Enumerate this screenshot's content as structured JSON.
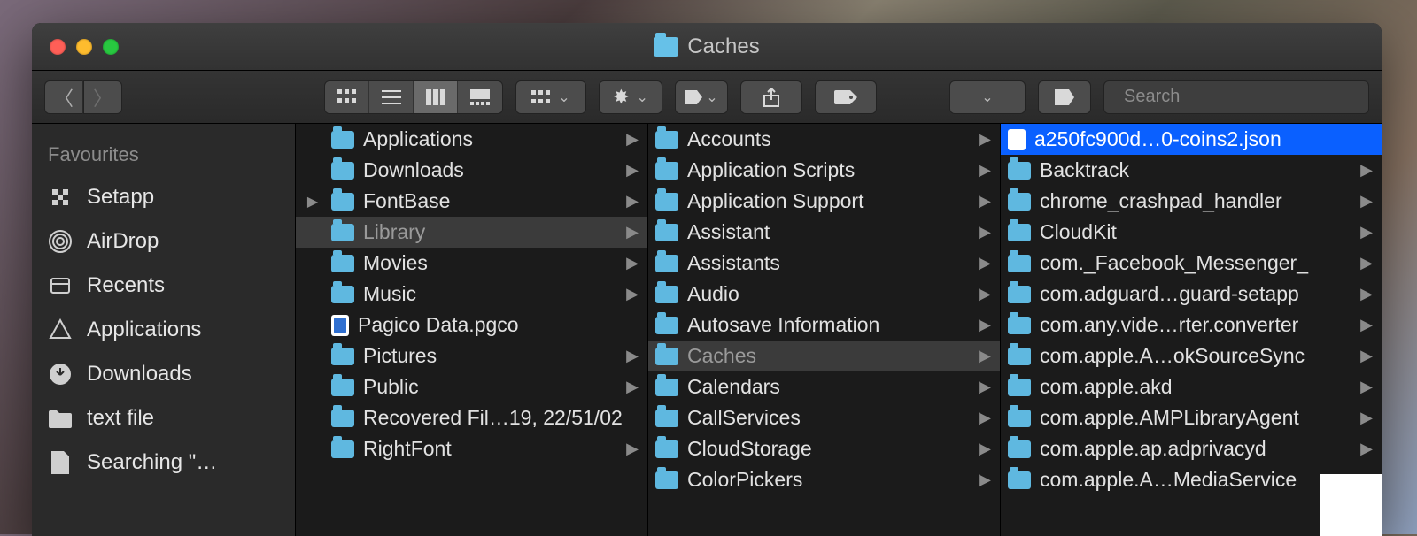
{
  "window": {
    "title": "Caches"
  },
  "toolbar": {
    "search_placeholder": "Search"
  },
  "sidebar": {
    "heading": "Favourites",
    "items": [
      {
        "label": "Setapp",
        "icon": "grid"
      },
      {
        "label": "AirDrop",
        "icon": "airdrop"
      },
      {
        "label": "Recents",
        "icon": "recents"
      },
      {
        "label": "Applications",
        "icon": "apps"
      },
      {
        "label": "Downloads",
        "icon": "download"
      },
      {
        "label": "text file",
        "icon": "folder"
      },
      {
        "label": "Searching \"…",
        "icon": "doc"
      }
    ]
  },
  "columns": [
    {
      "items": [
        {
          "name": "Applications",
          "type": "folder",
          "arrow": true
        },
        {
          "name": "Downloads",
          "type": "folder",
          "arrow": true
        },
        {
          "name": "FontBase",
          "type": "folder",
          "arrow": true,
          "lead": true
        },
        {
          "name": "Library",
          "type": "folder",
          "arrow": true,
          "sel": "path"
        },
        {
          "name": "Movies",
          "type": "folder",
          "arrow": true
        },
        {
          "name": "Music",
          "type": "folder",
          "arrow": true
        },
        {
          "name": "Pagico Data.pgco",
          "type": "bluefile",
          "arrow": false
        },
        {
          "name": "Pictures",
          "type": "folder",
          "arrow": true
        },
        {
          "name": "Public",
          "type": "folder",
          "arrow": true
        },
        {
          "name": "Recovered Fil…19, 22/51/02",
          "type": "folder",
          "arrow": false
        },
        {
          "name": "RightFont",
          "type": "folder",
          "arrow": true
        }
      ]
    },
    {
      "items": [
        {
          "name": "Accounts",
          "type": "folder",
          "arrow": true
        },
        {
          "name": "Application Scripts",
          "type": "folder",
          "arrow": true
        },
        {
          "name": "Application Support",
          "type": "folder",
          "arrow": true
        },
        {
          "name": "Assistant",
          "type": "folder",
          "arrow": true
        },
        {
          "name": "Assistants",
          "type": "folder",
          "arrow": true
        },
        {
          "name": "Audio",
          "type": "folder",
          "arrow": true
        },
        {
          "name": "Autosave Information",
          "type": "folder",
          "arrow": true
        },
        {
          "name": "Caches",
          "type": "folder",
          "arrow": true,
          "sel": "path"
        },
        {
          "name": "Calendars",
          "type": "folder",
          "arrow": true
        },
        {
          "name": "CallServices",
          "type": "folder",
          "arrow": true
        },
        {
          "name": "CloudStorage",
          "type": "folder",
          "arrow": true
        },
        {
          "name": "ColorPickers",
          "type": "folder",
          "arrow": true
        }
      ]
    },
    {
      "items": [
        {
          "name": "a250fc900d…0-coins2.json",
          "type": "doc",
          "arrow": false,
          "sel": "active"
        },
        {
          "name": "Backtrack",
          "type": "folder",
          "arrow": true
        },
        {
          "name": "chrome_crashpad_handler",
          "type": "folder",
          "arrow": true
        },
        {
          "name": "CloudKit",
          "type": "folder",
          "arrow": true
        },
        {
          "name": "com._Facebook_Messenger_",
          "type": "folder",
          "arrow": true
        },
        {
          "name": "com.adguard…guard-setapp",
          "type": "folder",
          "arrow": true
        },
        {
          "name": "com.any.vide…rter.converter",
          "type": "folder",
          "arrow": true
        },
        {
          "name": "com.apple.A…okSourceSync",
          "type": "folder",
          "arrow": true
        },
        {
          "name": "com.apple.akd",
          "type": "folder",
          "arrow": true
        },
        {
          "name": "com.apple.AMPLibraryAgent",
          "type": "folder",
          "arrow": true
        },
        {
          "name": "com.apple.ap.adprivacyd",
          "type": "folder",
          "arrow": true
        },
        {
          "name": "com.apple.A…MediaService",
          "type": "folder",
          "arrow": true
        }
      ]
    }
  ]
}
